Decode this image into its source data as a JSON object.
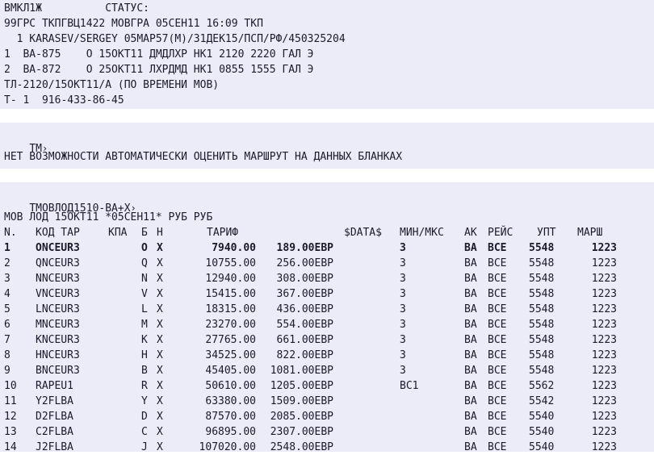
{
  "block1": {
    "lines": [
      "ВМКЛ1Ж          СТАТУС:",
      "99ГРС ТКПГВЦ1422 МОВГРА 05СЕН11 16:09 ТКП",
      "  1 KARASEV/SERGEY 05MAP57(M)/31ДЕК15/ПСП/РФ/450325204",
      "1  BA-875    O 15ОКТ11 ДМДЛХР НК1 2120 2220 ГАЛ Э",
      "2  BA-872    O 25ОКТ11 ЛХРДМД НК1 0855 1555 ГАЛ Э",
      "ТЛ-2120/15ОКТ11/А (ПО ВРЕМЕНИ МОВ)",
      "Т- 1  916-433-86-45"
    ]
  },
  "block2": {
    "prompt": "ТМ",
    "message": "НЕТ ВОЗМОЖНОСТИ АВТОМАТИЧЕСКИ ОЦЕНИТЬ МАРШРУТ НА ДАННЫХ БЛАНКАХ"
  },
  "block3": {
    "prompt": "ТМОВЛОД1510-BA+X",
    "query_line": "МОВ ЛОД 15ОКТ11 *05СЕН11* РУБ РУБ",
    "header": [
      "N.",
      "КОД ТАР",
      "КПА",
      "Б",
      "Н",
      "ТАРИФ",
      "$DATA$",
      "МИН/МКС",
      "АК",
      "РЕЙС",
      "УПТ",
      "МАРШ"
    ],
    "rows": [
      {
        "n": "1",
        "code": "ONCEUR3",
        "b": "O",
        "h": "X",
        "fare": "7940.00",
        "fee": "189.00ЕВР",
        "min": "3",
        "ak": "BA",
        "flt": "BCE",
        "upt": "5548",
        "route": "1223",
        "bold": true
      },
      {
        "n": "2",
        "code": "QNCEUR3",
        "b": "Q",
        "h": "X",
        "fare": "10755.00",
        "fee": "256.00ЕВР",
        "min": "3",
        "ak": "BA",
        "flt": "BCE",
        "upt": "5548",
        "route": "1223"
      },
      {
        "n": "3",
        "code": "NNCEUR3",
        "b": "N",
        "h": "X",
        "fare": "12940.00",
        "fee": "308.00ЕВР",
        "min": "3",
        "ak": "BA",
        "flt": "BCE",
        "upt": "5548",
        "route": "1223"
      },
      {
        "n": "4",
        "code": "VNCEUR3",
        "b": "V",
        "h": "X",
        "fare": "15415.00",
        "fee": "367.00ЕВР",
        "min": "3",
        "ak": "BA",
        "flt": "BCE",
        "upt": "5548",
        "route": "1223"
      },
      {
        "n": "5",
        "code": "LNCEUR3",
        "b": "L",
        "h": "X",
        "fare": "18315.00",
        "fee": "436.00ЕВР",
        "min": "3",
        "ak": "BA",
        "flt": "BCE",
        "upt": "5548",
        "route": "1223"
      },
      {
        "n": "6",
        "code": "MNCEUR3",
        "b": "M",
        "h": "X",
        "fare": "23270.00",
        "fee": "554.00ЕВР",
        "min": "3",
        "ak": "BA",
        "flt": "BCE",
        "upt": "5548",
        "route": "1223"
      },
      {
        "n": "7",
        "code": "KNCEUR3",
        "b": "K",
        "h": "X",
        "fare": "27765.00",
        "fee": "661.00ЕВР",
        "min": "3",
        "ak": "BA",
        "flt": "BCE",
        "upt": "5548",
        "route": "1223"
      },
      {
        "n": "8",
        "code": "HNCEUR3",
        "b": "H",
        "h": "X",
        "fare": "34525.00",
        "fee": "822.00ЕВР",
        "min": "3",
        "ak": "BA",
        "flt": "BCE",
        "upt": "5548",
        "route": "1223"
      },
      {
        "n": "9",
        "code": "BNCEUR3",
        "b": "B",
        "h": "X",
        "fare": "45405.00",
        "fee": "1081.00ЕВР",
        "min": "3",
        "ak": "BA",
        "flt": "BCE",
        "upt": "5548",
        "route": "1223"
      },
      {
        "n": "10",
        "code": "RAPEU1",
        "b": "R",
        "h": "X",
        "fare": "50610.00",
        "fee": "1205.00ЕВР",
        "min": "BC1",
        "ak": "BA",
        "flt": "BCE",
        "upt": "5562",
        "route": "1223"
      },
      {
        "n": "11",
        "code": "Y2FLBA",
        "b": "Y",
        "h": "X",
        "fare": "63380.00",
        "fee": "1509.00ЕВР",
        "min": "",
        "ak": "BA",
        "flt": "BCE",
        "upt": "5542",
        "route": "1223"
      },
      {
        "n": "12",
        "code": "D2FLBA",
        "b": "D",
        "h": "X",
        "fare": "87570.00",
        "fee": "2085.00ЕВР",
        "min": "",
        "ak": "BA",
        "flt": "BCE",
        "upt": "5540",
        "route": "1223"
      },
      {
        "n": "13",
        "code": "C2FLBA",
        "b": "C",
        "h": "X",
        "fare": "96895.00",
        "fee": "2307.00ЕВР",
        "min": "",
        "ak": "BA",
        "flt": "BCE",
        "upt": "5540",
        "route": "1223"
      },
      {
        "n": "14",
        "code": "J2FLBA",
        "b": "J",
        "h": "X",
        "fare": "107020.00",
        "fee": "2548.00ЕВР",
        "min": "",
        "ak": "BA",
        "flt": "BCE",
        "upt": "5540",
        "route": "1223"
      }
    ]
  },
  "icons": {
    "prompt_cursor": "chevron-right-icon"
  }
}
